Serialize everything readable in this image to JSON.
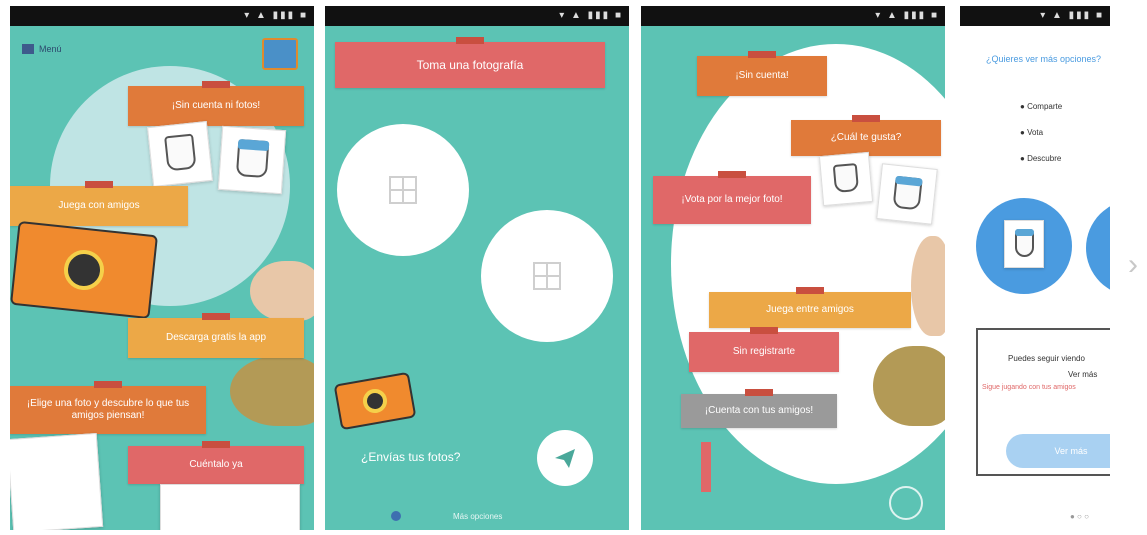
{
  "screen1": {
    "time": "",
    "status_icons": "▾ ▲ ▮▮▮ ■",
    "menu_label": "Menú",
    "tags": [
      "¡Sin cuenta ni fotos!",
      "Juega con amigos",
      "Descarga gratis la app",
      "¡Elige una foto y descubre lo que tus amigos piensan!",
      "Cuéntalo ya"
    ]
  },
  "screen2": {
    "title": "Toma una fotografía",
    "prompt": "¿Envías tus fotos?",
    "footer": "Más opciones"
  },
  "screen3": {
    "badge": "¡Sin cuenta!",
    "tags": [
      "¿Cuál te gusta?",
      "¡Vota por la mejor foto!",
      "Juega entre amigos",
      "Sin registrarte",
      "¡Cuenta con tus amigos!"
    ]
  },
  "screen4": {
    "question": "¿Quieres ver más opciones?",
    "bullets": [
      "Comparte",
      "Vota",
      "Descubre"
    ],
    "card_text": "Puedes seguir viendo",
    "card_link": "Ver más",
    "card_note": "Sigue jugando con tus amigos",
    "button": "Ver más",
    "pager": "● ○ ○"
  },
  "next_arrow": "›",
  "colors": {
    "teal": "#5cc3b4",
    "orange": "#e07a3a",
    "yellow": "#eca847",
    "red": "#e06868",
    "blue": "#4a9be0"
  }
}
